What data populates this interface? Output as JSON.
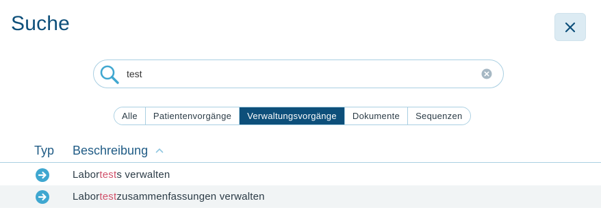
{
  "header": {
    "title": "Suche"
  },
  "search": {
    "value": "test",
    "placeholder": ""
  },
  "tabs": [
    {
      "label": "Alle",
      "active": false
    },
    {
      "label": "Patientenvorgänge",
      "active": false
    },
    {
      "label": "Verwaltungsvorgänge",
      "active": true
    },
    {
      "label": "Dokumente",
      "active": false
    },
    {
      "label": "Sequenzen",
      "active": false
    }
  ],
  "table": {
    "columns": {
      "type": "Typ",
      "description": "Beschreibung"
    },
    "rows": [
      {
        "icon": "arrow-right-circle-icon",
        "prefix": "Labor",
        "match": "test",
        "suffix": "s verwalten"
      },
      {
        "icon": "arrow-right-circle-icon",
        "prefix": "Labor",
        "match": "test",
        "suffix": "zusammenfassungen verwalten"
      }
    ]
  },
  "colors": {
    "primary": "#0d4f7a",
    "accent": "#3fa7d0",
    "highlight": "#d0506a",
    "border": "#a9cfe2"
  }
}
